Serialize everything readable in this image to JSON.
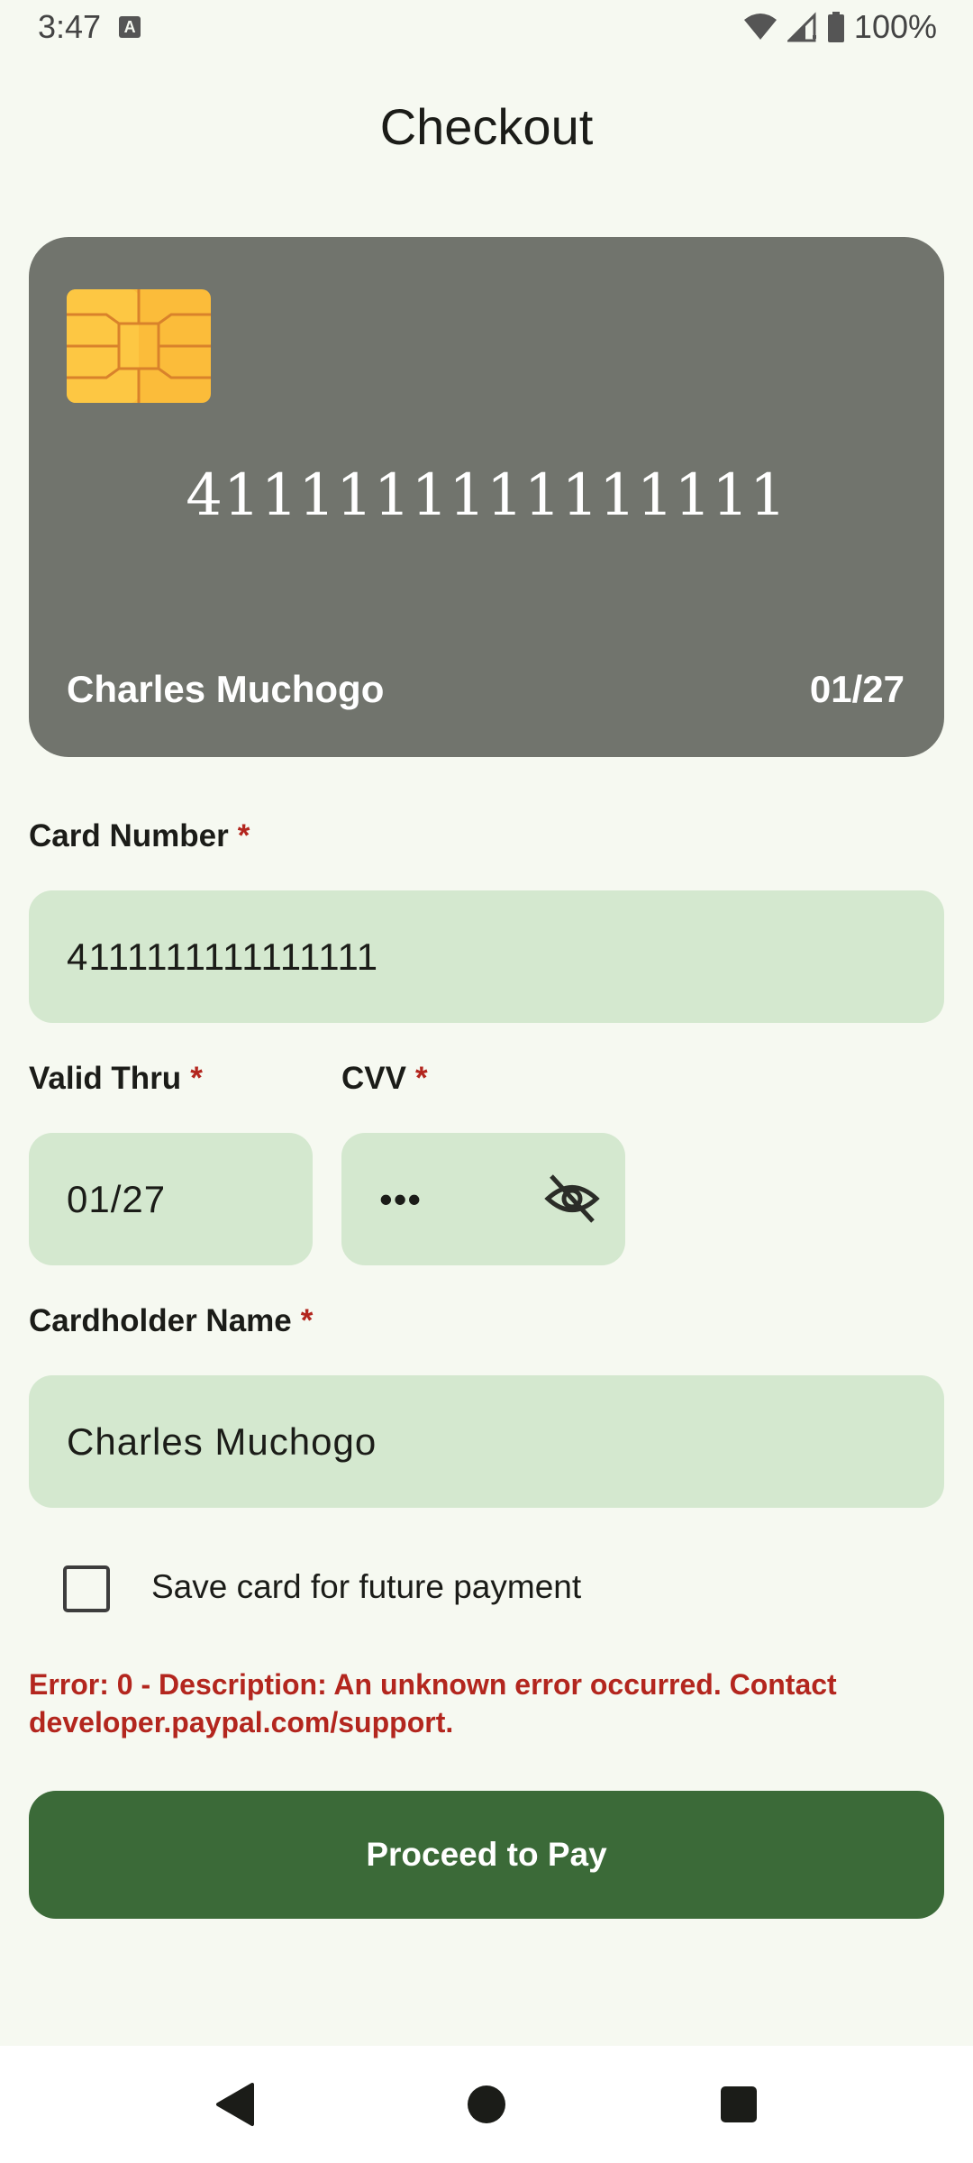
{
  "status_bar": {
    "time": "3:47",
    "badge": "A",
    "battery": "100%",
    "icons": [
      "wifi-icon",
      "cell-signal-icon",
      "battery-icon"
    ]
  },
  "page": {
    "title": "Checkout"
  },
  "card_preview": {
    "number": "4111111111111111",
    "holder": "Charles Muchogo",
    "expiry": "01/27",
    "background_color": "#71746d",
    "chip_color": "#fbbc3a"
  },
  "form": {
    "card_number": {
      "label": "Card Number",
      "required_mark": "*",
      "value": "4111111111111111"
    },
    "valid_thru": {
      "label": "Valid Thru",
      "required_mark": "*",
      "value": "01/27"
    },
    "cvv": {
      "label": "CVV",
      "required_mark": "*",
      "value": "•••",
      "toggle_icon": "eye-off-icon"
    },
    "cardholder_name": {
      "label": "Cardholder Name",
      "required_mark": "*",
      "value": "Charles Muchogo"
    },
    "save_card": {
      "label": "Save card for future payment",
      "checked": false
    }
  },
  "error": {
    "message": "Error: 0 - Description: An unknown error occurred. Contact developer.paypal.com/support.",
    "color": "#b3261e"
  },
  "actions": {
    "pay_label": "Proceed to Pay",
    "pay_color": "#3b6a38"
  },
  "nav_bar": {
    "icons": [
      "back-icon",
      "home-icon",
      "recents-icon"
    ]
  },
  "colors": {
    "background": "#f6f9f1",
    "input_fill": "#d4e8cf"
  }
}
